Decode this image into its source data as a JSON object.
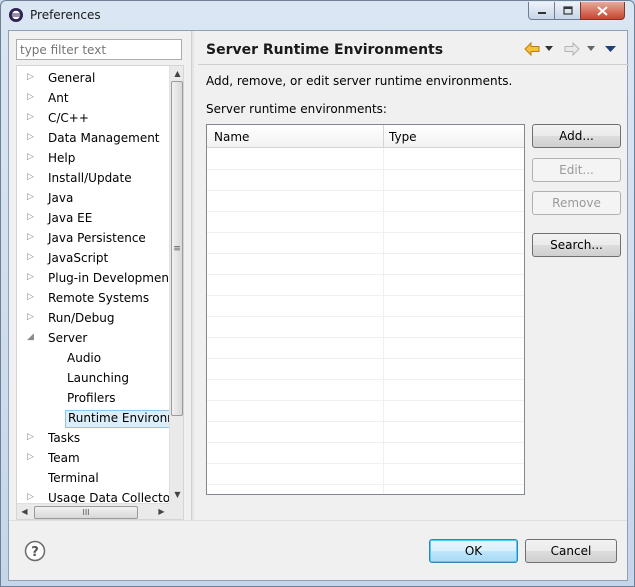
{
  "window": {
    "title": "Preferences"
  },
  "filter": {
    "placeholder": "type filter text"
  },
  "tree": {
    "items": [
      {
        "label": "General",
        "expandable": true
      },
      {
        "label": "Ant",
        "expandable": true
      },
      {
        "label": "C/C++",
        "expandable": true
      },
      {
        "label": "Data Management",
        "expandable": true
      },
      {
        "label": "Help",
        "expandable": true
      },
      {
        "label": "Install/Update",
        "expandable": true
      },
      {
        "label": "Java",
        "expandable": true
      },
      {
        "label": "Java EE",
        "expandable": true
      },
      {
        "label": "Java Persistence",
        "expandable": true
      },
      {
        "label": "JavaScript",
        "expandable": true
      },
      {
        "label": "Plug-in Development",
        "expandable": true
      },
      {
        "label": "Remote Systems",
        "expandable": true
      },
      {
        "label": "Run/Debug",
        "expandable": true
      },
      {
        "label": "Server",
        "expandable": true,
        "expanded": true
      },
      {
        "label": "Audio",
        "child": true
      },
      {
        "label": "Launching",
        "child": true
      },
      {
        "label": "Profilers",
        "child": true
      },
      {
        "label": "Runtime Environm",
        "child": true,
        "selected": true
      },
      {
        "label": "Tasks",
        "expandable": true
      },
      {
        "label": "Team",
        "expandable": true
      },
      {
        "label": "Terminal",
        "expandable": false
      },
      {
        "label": "Usage Data Collector",
        "expandable": true
      }
    ],
    "hscroll_grip": "III",
    "vscroll_grip": "≡"
  },
  "page": {
    "title": "Server Runtime Environments",
    "description": "Add, remove, or edit server runtime environments.",
    "table_label": "Server runtime environments:",
    "columns": [
      "Name",
      "Type"
    ],
    "rows": []
  },
  "buttons": {
    "add": "Add...",
    "edit": "Edit...",
    "remove": "Remove",
    "search": "Search...",
    "ok": "OK",
    "cancel": "Cancel"
  },
  "colors": {
    "nav_arrow_active": "#e8a628",
    "nav_arrow_disabled": "#b5b5b5",
    "selection": "#dceefa"
  }
}
